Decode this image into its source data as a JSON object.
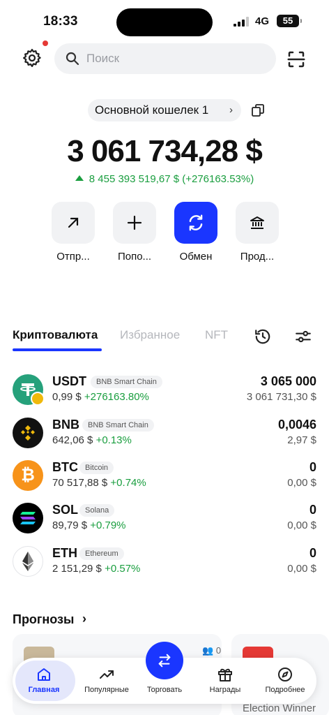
{
  "status_bar": {
    "time": "18:33",
    "network": "4G",
    "battery": "55"
  },
  "search": {
    "placeholder": "Поиск"
  },
  "wallet": {
    "name": "Основной кошелек 1",
    "balance": "3 061 734,28 $",
    "change": "8 455 393 519,67 $ (+276163.53%)"
  },
  "actions": [
    {
      "label": "Отпр...",
      "icon": "arrow-up-right-icon"
    },
    {
      "label": "Попо...",
      "icon": "plus-icon"
    },
    {
      "label": "Обмен",
      "icon": "swap-icon"
    },
    {
      "label": "Прод...",
      "icon": "bank-icon"
    }
  ],
  "tabs": [
    {
      "label": "Криптовалюта",
      "active": true
    },
    {
      "label": "Избранное",
      "active": false
    },
    {
      "label": "NFT",
      "active": false
    }
  ],
  "assets": [
    {
      "symbol": "USDT",
      "network": "BNB Smart Chain",
      "price": "0,99 $",
      "change": "+276163.80%",
      "amount": "3 065 000",
      "fiat": "3 061 731,30 $",
      "color": "#26a17b"
    },
    {
      "symbol": "BNB",
      "network": "BNB Smart Chain",
      "price": "642,06 $",
      "change": "+0.13%",
      "amount": "0,0046",
      "fiat": "2,97 $",
      "color": "#111111"
    },
    {
      "symbol": "BTC",
      "network": "Bitcoin",
      "price": "70 517,88 $",
      "change": "+0.74%",
      "amount": "0",
      "fiat": "0,00 $",
      "color": "#f7931a"
    },
    {
      "symbol": "SOL",
      "network": "Solana",
      "price": "89,79 $",
      "change": "+0.79%",
      "amount": "0",
      "fiat": "0,00 $",
      "color": "#000000"
    },
    {
      "symbol": "ETH",
      "network": "Ethereum",
      "price": "2 151,29 $",
      "change": "+0.57%",
      "amount": "0",
      "fiat": "0,00 $",
      "color": "#ffffff"
    }
  ],
  "forecasts": {
    "title": "Прогнозы",
    "card1_users": "0",
    "card2_text": "Election Winner"
  },
  "bottom_nav": [
    {
      "label": "Главная",
      "active": true
    },
    {
      "label": "Популярные",
      "active": false
    },
    {
      "label": "Торговать",
      "active": false
    },
    {
      "label": "Награды",
      "active": false
    },
    {
      "label": "Подробнее",
      "active": false
    }
  ],
  "colors": {
    "accent": "#1a36ff",
    "positive": "#1a9e3f",
    "surface": "#f1f2f4"
  }
}
